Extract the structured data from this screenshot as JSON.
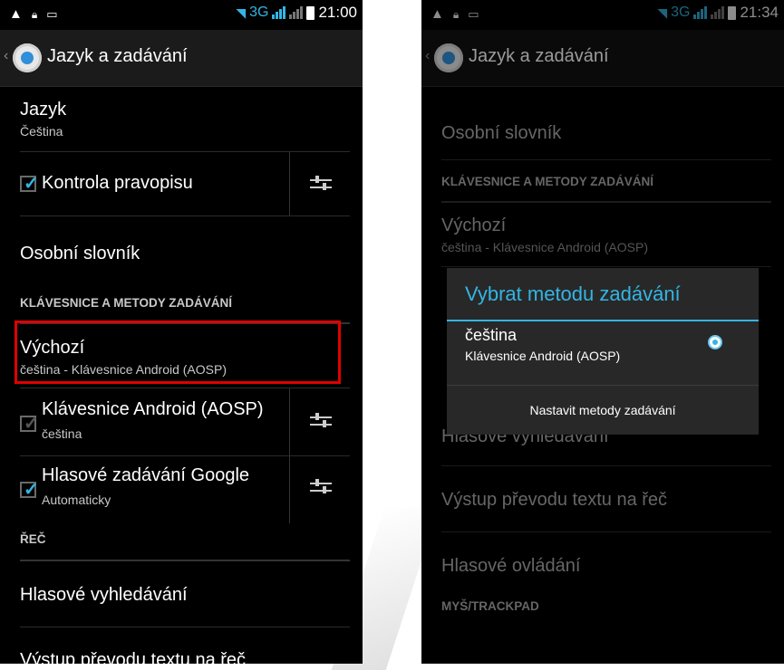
{
  "left": {
    "status": {
      "network": "3G",
      "time": "21:00"
    },
    "actionbar": {
      "title": "Jazyk a zadávání"
    },
    "items": {
      "jazyk": {
        "title": "Jazyk",
        "summary": "Čeština"
      },
      "kontrola": {
        "title": "Kontrola pravopisu",
        "checked": true
      },
      "slovnik": {
        "title": "Osobní slovník"
      },
      "category_keyboards": "KLÁVESNICE A METODY ZADÁVÁNÍ",
      "vychozi": {
        "title": "Výchozí",
        "summary": "čeština - Klávesnice Android (AOSP)"
      },
      "aosp": {
        "title": "Klávesnice Android (AOSP)",
        "summary": "čeština",
        "checked": true
      },
      "google_voice": {
        "title": "Hlasové zadávání Google",
        "summary": "Automaticky",
        "checked": true
      },
      "category_speech": "ŘEČ",
      "voice_search": {
        "title": "Hlasové vyhledávání"
      },
      "tts": {
        "title": "Výstup převodu textu na řeč"
      }
    },
    "highlight_color": "#e00000"
  },
  "right": {
    "status": {
      "network": "3G",
      "time": "21:34"
    },
    "actionbar": {
      "title": "Jazyk a zadávání"
    },
    "items": {
      "slovnik": {
        "title": "Osobní slovník"
      },
      "category_keyboards": "KLÁVESNICE A METODY ZADÁVÁNÍ",
      "vychozi": {
        "title": "Výchozí",
        "summary": "čeština - Klávesnice Android (AOSP)"
      },
      "voice_search": {
        "title": "Hlasové vyhledávání"
      },
      "tts": {
        "title": "Výstup převodu textu na řeč"
      },
      "voice_control": {
        "title": "Hlasové ovládání"
      },
      "category_mouse": "MYŠ/TRACKPAD"
    },
    "dialog": {
      "title": "Vybrat metodu zadávání",
      "option_title": "čeština",
      "option_subtitle": "Klávesnice Android (AOSP)",
      "option_selected": true,
      "button": "Nastavit metody zadávání"
    }
  },
  "accent_color": "#33b5e5"
}
